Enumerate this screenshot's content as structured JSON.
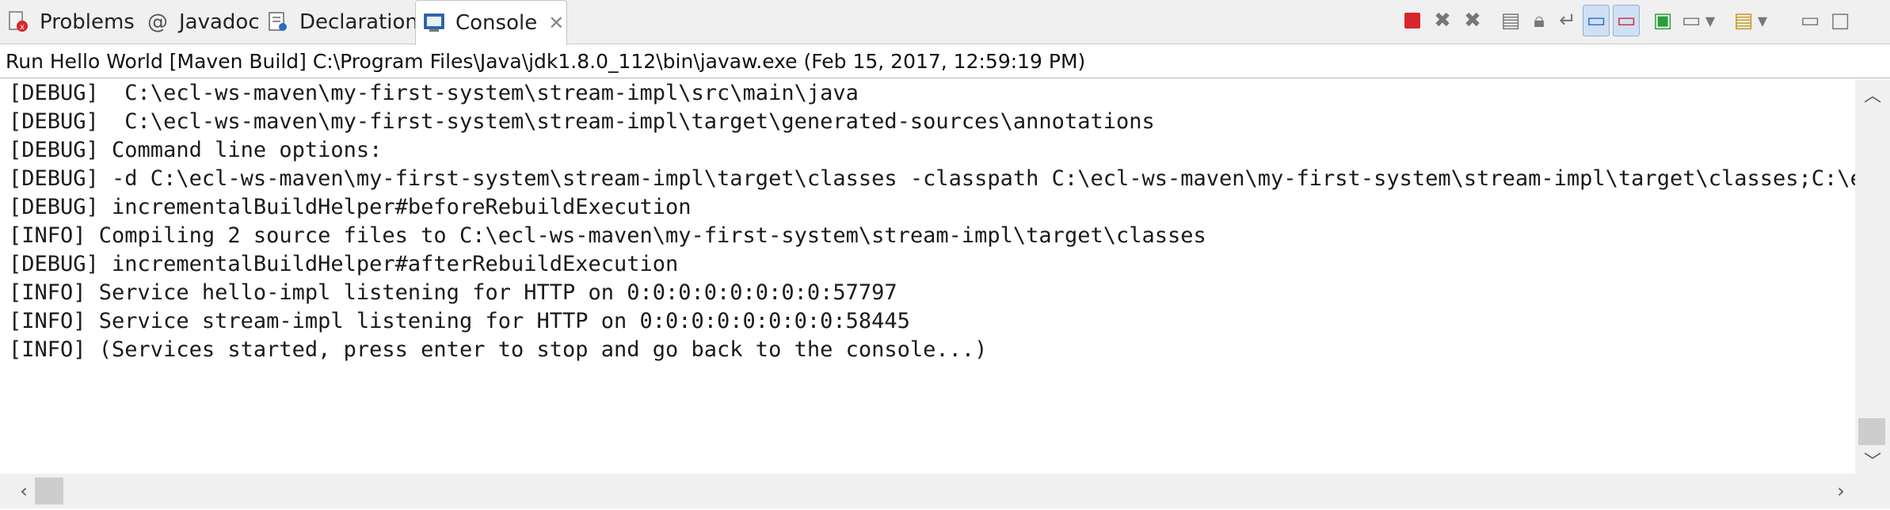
{
  "tabs": [
    {
      "label": "Problems",
      "icon": "problems-icon"
    },
    {
      "label": "Javadoc",
      "icon": "javadoc-icon"
    },
    {
      "label": "Declaration",
      "icon": "declaration-icon"
    },
    {
      "label": "Console",
      "icon": "console-icon",
      "active": true
    }
  ],
  "colors": {
    "terminate": "#d9262c",
    "tab_active_border": "#b9c6d8",
    "accent": "#2b6cc4"
  },
  "launch": {
    "description": "Run Hello World [Maven Build] C:\\Program Files\\Java\\jdk1.8.0_112\\bin\\javaw.exe (Feb 15, 2017, 12:59:19 PM)"
  },
  "console": {
    "lines": [
      "[DEBUG]  C:\\ecl-ws-maven\\my-first-system\\stream-impl\\src\\main\\java",
      "[DEBUG]  C:\\ecl-ws-maven\\my-first-system\\stream-impl\\target\\generated-sources\\annotations",
      "[DEBUG] Command line options:",
      "[DEBUG] -d C:\\ecl-ws-maven\\my-first-system\\stream-impl\\target\\classes -classpath C:\\ecl-ws-maven\\my-first-system\\stream-impl\\target\\classes;C:\\ecl",
      "[DEBUG] incrementalBuildHelper#beforeRebuildExecution",
      "[INFO] Compiling 2 source files to C:\\ecl-ws-maven\\my-first-system\\stream-impl\\target\\classes",
      "[DEBUG] incrementalBuildHelper#afterRebuildExecution",
      "[INFO] Service hello-impl listening for HTTP on 0:0:0:0:0:0:0:0:57797",
      "[INFO] Service stream-impl listening for HTTP on 0:0:0:0:0:0:0:0:58445",
      "[INFO] (Services started, press enter to stop and go back to the console...)"
    ]
  }
}
